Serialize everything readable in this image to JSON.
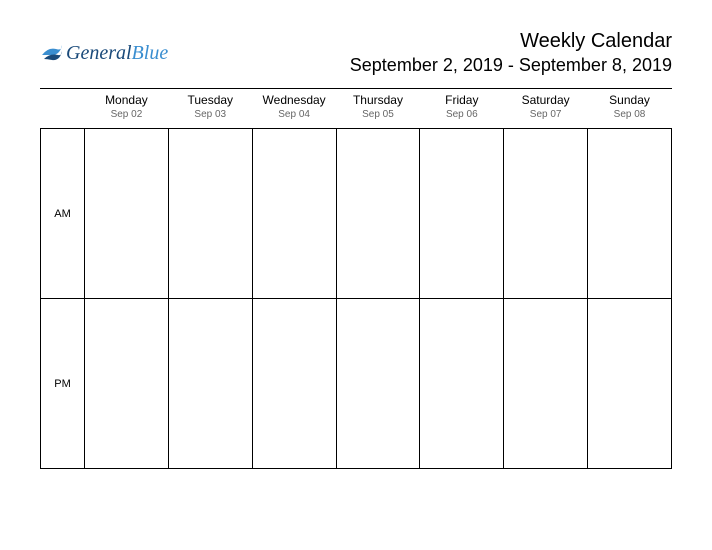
{
  "logo": {
    "part1": "General",
    "part2": "Blue"
  },
  "header": {
    "title": "Weekly Calendar",
    "date_range": "September 2, 2019 - September 8, 2019"
  },
  "days": [
    {
      "name": "Monday",
      "date": "Sep 02"
    },
    {
      "name": "Tuesday",
      "date": "Sep 03"
    },
    {
      "name": "Wednesday",
      "date": "Sep 04"
    },
    {
      "name": "Thursday",
      "date": "Sep 05"
    },
    {
      "name": "Friday",
      "date": "Sep 06"
    },
    {
      "name": "Saturday",
      "date": "Sep 07"
    },
    {
      "name": "Sunday",
      "date": "Sep 08"
    }
  ],
  "periods": {
    "am": "AM",
    "pm": "PM"
  }
}
